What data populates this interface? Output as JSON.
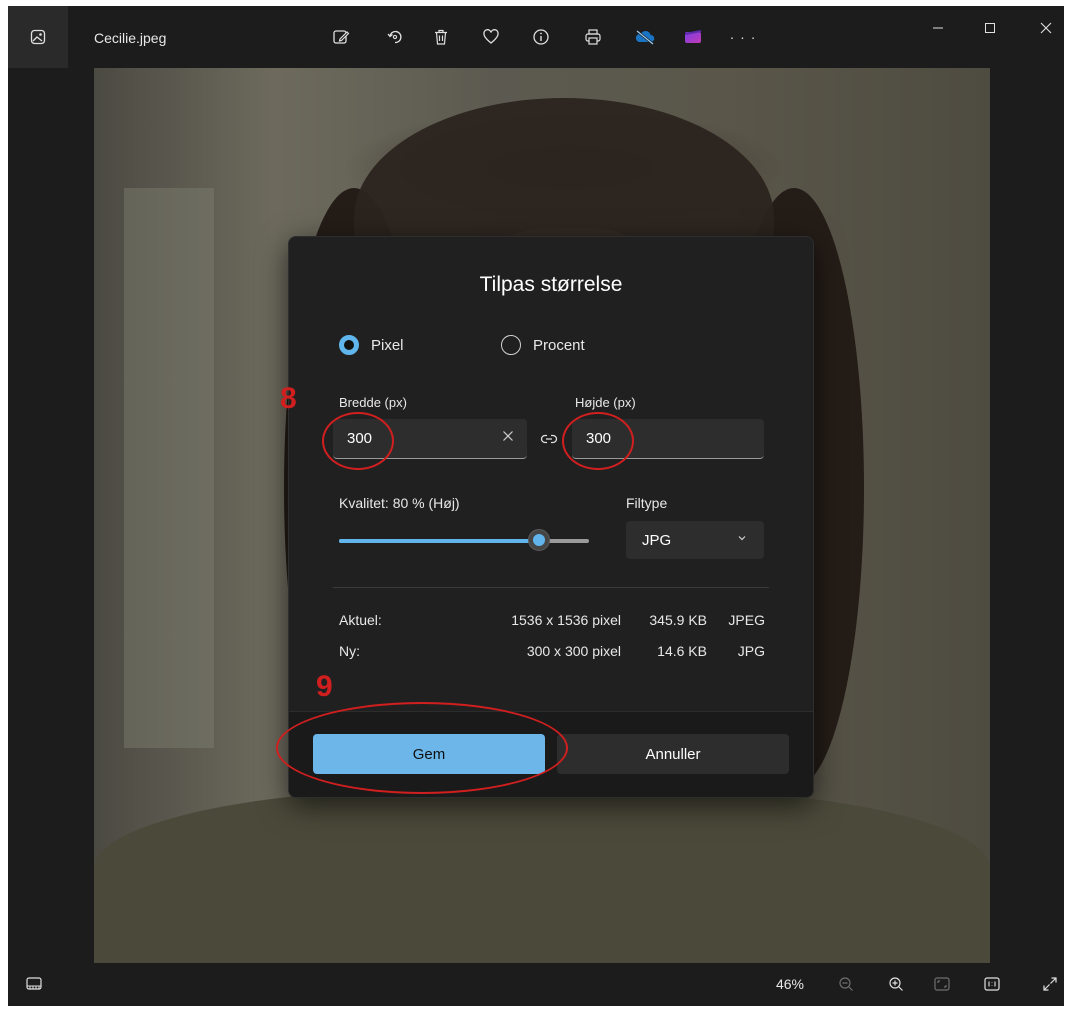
{
  "window": {
    "filename": "Cecilie.jpeg",
    "toolbar_icons": [
      "edit-icon",
      "rotate-icon",
      "delete-icon",
      "favorite-icon",
      "info-icon",
      "print-icon",
      "onedrive-icon",
      "clipchamp-icon",
      "more-icon"
    ],
    "more_label": "· · ·"
  },
  "dialog": {
    "title": "Tilpas størrelse",
    "unit_options": [
      {
        "label": "Pixel",
        "selected": true
      },
      {
        "label": "Procent",
        "selected": false
      }
    ],
    "width_label": "Bredde (px)",
    "width_value": "300",
    "height_label": "Højde (px)",
    "height_value": "300",
    "quality_label": "Kvalitet: 80 % (Høj)",
    "quality_percent": 80,
    "filetype_label": "Filtype",
    "filetype_value": "JPG",
    "current": {
      "label": "Aktuel:",
      "dimensions": "1536 x 1536 pixel",
      "size": "345.9 KB",
      "type": "JPEG"
    },
    "new": {
      "label": "Ny:",
      "dimensions": "300 x 300 pixel",
      "size": "14.6 KB",
      "type": "JPG"
    },
    "save_label": "Gem",
    "cancel_label": "Annuller"
  },
  "statusbar": {
    "zoom": "46%"
  },
  "annotations": {
    "step_8": "8",
    "step_9": "9",
    "color": "#d11f1f"
  },
  "colors": {
    "accent": "#60b5ec",
    "primary_button": "#6cb6ea",
    "dialog_bg": "#202020",
    "window_bg": "#1c1c1c"
  }
}
